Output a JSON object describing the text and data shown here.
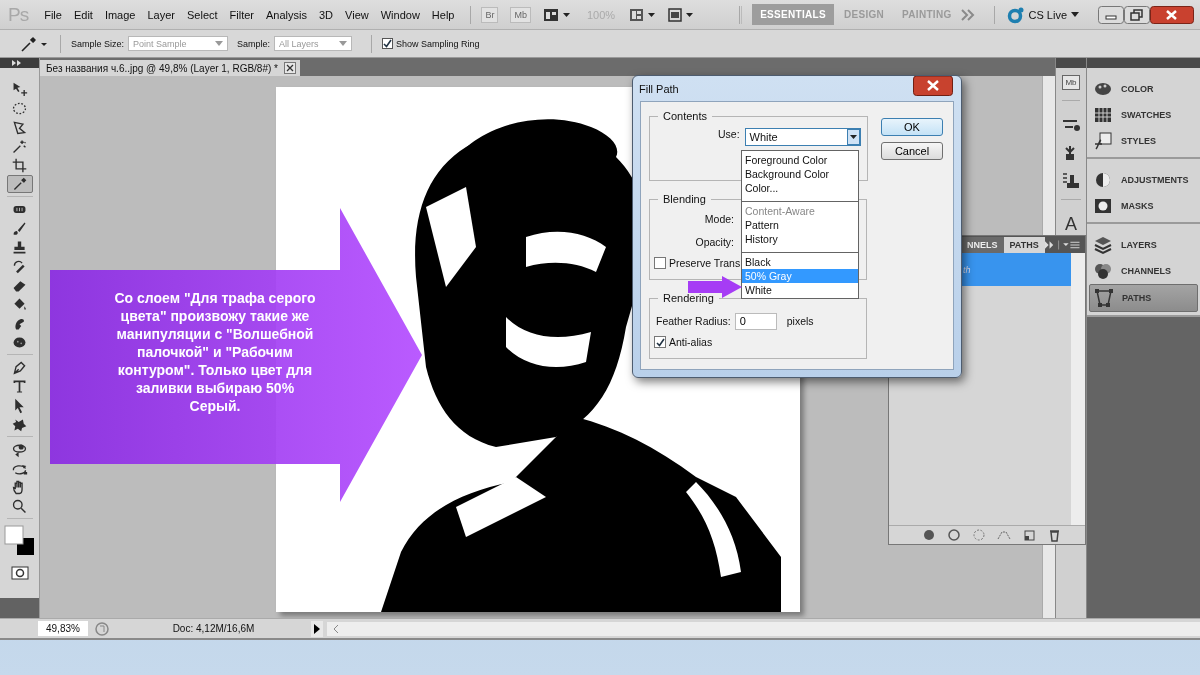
{
  "app": {
    "logo": "Ps",
    "menu": [
      "File",
      "Edit",
      "Image",
      "Layer",
      "Select",
      "Filter",
      "Analysis",
      "3D",
      "View",
      "Window",
      "Help"
    ],
    "bridge": "Br",
    "mini_bridge": "Mb",
    "zoom": "100%",
    "workspaces": [
      {
        "label": "ESSENTIALS",
        "selected": true
      },
      {
        "label": "DESIGN",
        "selected": false
      },
      {
        "label": "PAINTING",
        "selected": false
      }
    ],
    "cs_live": "CS Live"
  },
  "options": {
    "sample_size_label": "Sample Size:",
    "sample_size": "Point Sample",
    "sample_label": "Sample:",
    "sample": "All Layers",
    "sampling_ring": {
      "label": "Show Sampling Ring",
      "checked": true
    }
  },
  "tool_groups": [
    {
      "tools": [
        {
          "kind": "move",
          "selected": false
        },
        {
          "kind": "marquee",
          "selected": false
        },
        {
          "kind": "lasso",
          "selected": false
        },
        {
          "kind": "wand",
          "selected": false
        },
        {
          "kind": "crop",
          "selected": false
        },
        {
          "kind": "eyedropper",
          "selected": true
        }
      ]
    },
    {
      "tools": [
        {
          "kind": "healing",
          "selected": false
        },
        {
          "kind": "brush",
          "selected": false
        },
        {
          "kind": "stamp",
          "selected": false
        },
        {
          "kind": "history",
          "selected": false
        },
        {
          "kind": "eraser",
          "selected": false
        },
        {
          "kind": "bucket",
          "selected": false
        },
        {
          "kind": "blur",
          "selected": false
        },
        {
          "kind": "sponge",
          "selected": false
        }
      ]
    },
    {
      "tools": [
        {
          "kind": "pen",
          "selected": false
        },
        {
          "kind": "type",
          "selected": false
        },
        {
          "kind": "path",
          "selected": false
        },
        {
          "kind": "shape",
          "selected": false
        }
      ]
    },
    {
      "tools": [
        {
          "kind": "rotate3d",
          "selected": false
        },
        {
          "kind": "orbit3d",
          "selected": false
        },
        {
          "kind": "hand",
          "selected": false
        },
        {
          "kind": "zoom",
          "selected": false
        }
      ]
    }
  ],
  "document": {
    "tab": "Без названия ч.6..jpg @ 49,8% (Layer 1, RGB/8#) *"
  },
  "status_bar": {
    "zoom": "49,83%",
    "doc": "Doc: 4,12M/16,6M"
  },
  "panel_strip": [
    {
      "kind": "mini-bridge",
      "label": "Mb"
    },
    {
      "kind": "brushes"
    },
    {
      "kind": "clone-source"
    },
    {
      "kind": "tool-presets"
    },
    {
      "kind": "character",
      "label": "A"
    }
  ],
  "panel_groups": [
    {
      "items": [
        {
          "kind": "color",
          "label": "COLOR",
          "selected": false
        },
        {
          "kind": "swatches",
          "label": "SWATCHES",
          "selected": false
        },
        {
          "kind": "styles",
          "label": "STYLES",
          "selected": false
        }
      ]
    },
    {
      "items": [
        {
          "kind": "adjustments",
          "label": "ADJUSTMENTS",
          "selected": false
        },
        {
          "kind": "masks",
          "label": "MASKS",
          "selected": false
        }
      ]
    },
    {
      "items": [
        {
          "kind": "layers",
          "label": "LAYERS",
          "selected": false
        },
        {
          "kind": "channels",
          "label": "CHANNELS",
          "selected": false
        },
        {
          "kind": "paths",
          "label": "PATHS",
          "selected": true
        }
      ]
    }
  ],
  "paths_panel": {
    "tabs": [
      {
        "label": "NNELS",
        "selected": false
      },
      {
        "label": "PATHS",
        "selected": true
      }
    ],
    "rows": [
      {
        "label": "th",
        "selected": true
      }
    ]
  },
  "dialog": {
    "title": "Fill Path",
    "contents": {
      "legend": "Contents",
      "use_label": "Use:",
      "use_value": "White"
    },
    "blending": {
      "legend": "Blending",
      "mode_label": "Mode:",
      "opacity_label": "Opacity:",
      "preserve": {
        "label": "Preserve Trans",
        "checked": false
      }
    },
    "rendering": {
      "legend": "Rendering",
      "feather_label": "Feather Radius:",
      "feather_value": "0",
      "feather_unit": "pixels",
      "antialias": {
        "label": "Anti-alias",
        "checked": true
      }
    },
    "buttons": [
      {
        "label": "OK",
        "default": true
      },
      {
        "label": "Cancel",
        "default": false
      }
    ],
    "use_options": [
      {
        "options": [
          {
            "label": "Foreground Color",
            "disabled": false,
            "selected": false
          },
          {
            "label": "Background Color",
            "disabled": false,
            "selected": false
          },
          {
            "label": "Color...",
            "disabled": false,
            "selected": false
          }
        ]
      },
      {
        "options": [
          {
            "label": "Content-Aware",
            "disabled": true,
            "selected": false
          },
          {
            "label": "Pattern",
            "disabled": false,
            "selected": false
          },
          {
            "label": "History",
            "disabled": false,
            "selected": false
          }
        ]
      },
      {
        "options": [
          {
            "label": "Black",
            "disabled": false,
            "selected": false
          },
          {
            "label": "50% Gray",
            "disabled": false,
            "selected": true
          },
          {
            "label": "White",
            "disabled": false,
            "selected": false
          }
        ]
      }
    ]
  },
  "callout": {
    "text": "Со слоем \"Для трафа серого цвета\" произвожу такие же манипуляции с \"Волшебной палочкой\" и \"Рабочим контуром\". Только цвет для заливки выбираю 50% Серый."
  }
}
